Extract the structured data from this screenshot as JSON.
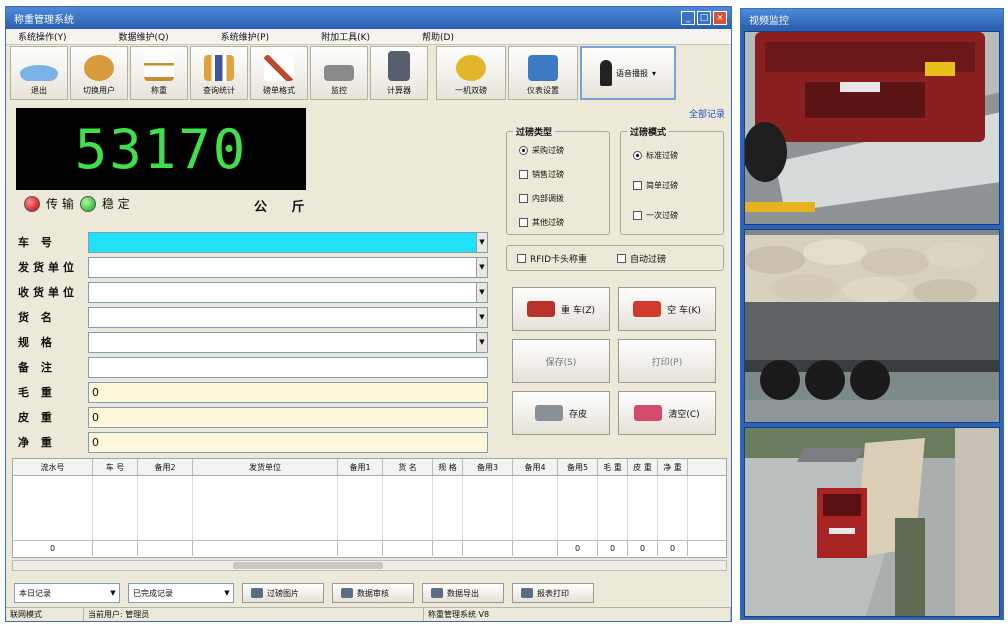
{
  "main_window": {
    "title": "称重管理系统"
  },
  "menu": [
    "系统操作(Y)",
    "数据维护(Q)",
    "系统维护(P)",
    "附加工具(K)",
    "帮助(D)"
  ],
  "toolbar": [
    {
      "label": "退出",
      "icon": "exit-icon",
      "color": "#7bb3e8"
    },
    {
      "label": "切换用户",
      "icon": "switch-user-icon",
      "color": "#d89b3c"
    },
    {
      "label": "称重",
      "icon": "scale-icon",
      "color": "#c98d2a"
    },
    {
      "label": "查询统计",
      "icon": "chart-icon",
      "color": "#e0a23a"
    },
    {
      "label": "磅单格式",
      "icon": "tools-icon",
      "color": "#c0492c"
    },
    {
      "label": "监控",
      "icon": "camera-icon",
      "color": "#8a8a8a"
    },
    {
      "label": "计算器",
      "icon": "calculator-icon",
      "color": "#555f6e"
    },
    {
      "label": "一机双磅",
      "icon": "dual-scale-icon",
      "color": "#e2b52b"
    },
    {
      "label": "仪表设置",
      "icon": "monitor-settings-icon",
      "color": "#3d7ac4"
    }
  ],
  "voice_button": "语音播报",
  "all_records_link": "全部记录",
  "weight_display": "53170",
  "status": {
    "transmit": "传 输",
    "stable": "稳 定"
  },
  "unit": "公 斤",
  "form": [
    {
      "label": "车 号",
      "value": "",
      "style": "hl",
      "dropdown": true
    },
    {
      "label": "发货单位",
      "value": "",
      "style": "",
      "dropdown": true
    },
    {
      "label": "收货单位",
      "value": "",
      "style": "",
      "dropdown": true
    },
    {
      "label": "货 名",
      "value": "",
      "style": "",
      "dropdown": true
    },
    {
      "label": "规 格",
      "value": "",
      "style": "",
      "dropdown": true
    },
    {
      "label": "备 注",
      "value": "",
      "style": "",
      "dropdown": false
    },
    {
      "label": "毛 重",
      "value": "0",
      "style": "cream",
      "dropdown": false
    },
    {
      "label": "皮 重",
      "value": "0",
      "style": "cream",
      "dropdown": false
    },
    {
      "label": "净 重",
      "value": "0",
      "style": "cream",
      "dropdown": false
    }
  ],
  "weigh_type": {
    "title": "过磅类型",
    "options": [
      {
        "label": "采购过磅",
        "checked": true,
        "kind": "radio"
      },
      {
        "label": "销售过磅",
        "checked": false,
        "kind": "check"
      },
      {
        "label": "内部调拨",
        "checked": false,
        "kind": "check"
      },
      {
        "label": "其他过磅",
        "checked": false,
        "kind": "check"
      }
    ]
  },
  "weigh_mode": {
    "title": "过磅模式",
    "options": [
      {
        "label": "标准过磅",
        "checked": true,
        "kind": "radio"
      },
      {
        "label": "简单过磅",
        "checked": false,
        "kind": "check"
      },
      {
        "label": "一次过磅",
        "checked": false,
        "kind": "check"
      }
    ]
  },
  "extra_options": {
    "rfid": "RFID卡头称重",
    "auto": "自动过磅"
  },
  "buttons": {
    "heavy": "重 车(Z)",
    "empty": "空 车(K)",
    "save": "保存(S)",
    "print": "打印(P)",
    "tare": "存皮",
    "clear": "清空(C)"
  },
  "table": {
    "columns": [
      "流水号",
      "车 号",
      "备用2",
      "发货单位",
      "备用1",
      "货 名",
      "规 格",
      "备用3",
      "备用4",
      "备用5",
      "毛 重",
      "皮 重",
      "净 重"
    ],
    "footer": [
      "0",
      "",
      "",
      "",
      "",
      "",
      "",
      "",
      "",
      "0",
      "0",
      "0",
      "0"
    ]
  },
  "bottom": {
    "filter1": "本日记录",
    "filter2": "已完成记录",
    "btn_image": "过磅图片",
    "btn_approve": "数据审核",
    "btn_export": "数据导出",
    "btn_print": "报表打印"
  },
  "statusbar": [
    "联网模式",
    "当前用户: 管理员",
    "称重管理系统 V8"
  ],
  "camera_window": {
    "title": "视频监控"
  }
}
